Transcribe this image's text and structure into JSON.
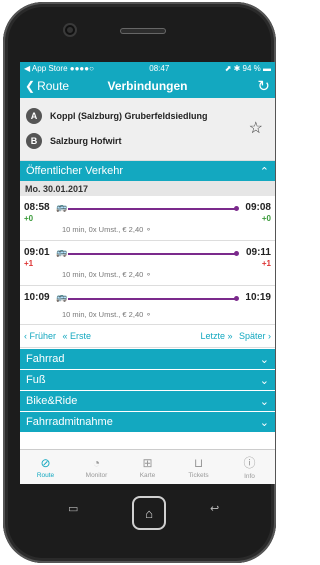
{
  "status": {
    "carrier": "◀ App Store ●●●●○ ",
    "time": "08:47",
    "battery": "⬈ ✱ 94 % ▬"
  },
  "nav": {
    "back_label": "Route",
    "title": "Verbindungen",
    "refresh_icon": "↻"
  },
  "route": {
    "from_letter": "A",
    "from": "Koppl (Salzburg) Gruberfeldsiedlung",
    "to_letter": "B",
    "to": "Salzburg Hofwirt",
    "star_icon": "☆"
  },
  "section_public": {
    "label": "Öffentlicher Verkehr",
    "chev": "⌃"
  },
  "date": "Mo. 30.01.2017",
  "connections": [
    {
      "dep": "08:58",
      "arr": "09:08",
      "dep_delay": "+0",
      "arr_delay": "+0",
      "info": "10 min, 0x Umst., € 2,40 ⚬"
    },
    {
      "dep": "09:01",
      "arr": "09:11",
      "dep_delay": "+1",
      "arr_delay": "+1",
      "info": "10 min, 0x Umst., € 2,40 ⚬"
    },
    {
      "dep": "10:09",
      "arr": "10:19",
      "dep_delay": "",
      "arr_delay": "",
      "info": "10 min, 0x Umst., € 2,40 ⚬"
    }
  ],
  "pager": {
    "earlier": "‹ Früher",
    "first": "« Erste",
    "last": "Letzte »",
    "later": "Später ›"
  },
  "sections": [
    {
      "label": "Fahrrad",
      "chev": "⌄"
    },
    {
      "label": "Fuß",
      "chev": "⌄"
    },
    {
      "label": "Bike&Ride",
      "chev": "⌄"
    },
    {
      "label": "Fahrradmitnahme",
      "chev": "⌄"
    }
  ],
  "tabs": [
    {
      "label": "Route",
      "icon": "⊘"
    },
    {
      "label": "Monitor",
      "icon": "◔"
    },
    {
      "label": "Karte",
      "icon": "⊞"
    },
    {
      "label": "Tickets",
      "icon": "⊔"
    },
    {
      "label": "Info",
      "icon": "ⓘ"
    }
  ],
  "colors": {
    "accent": "#13a8c0",
    "line": "#7b2a8c",
    "on_time": "#3a9a3a",
    "delay": "#dd3333"
  }
}
